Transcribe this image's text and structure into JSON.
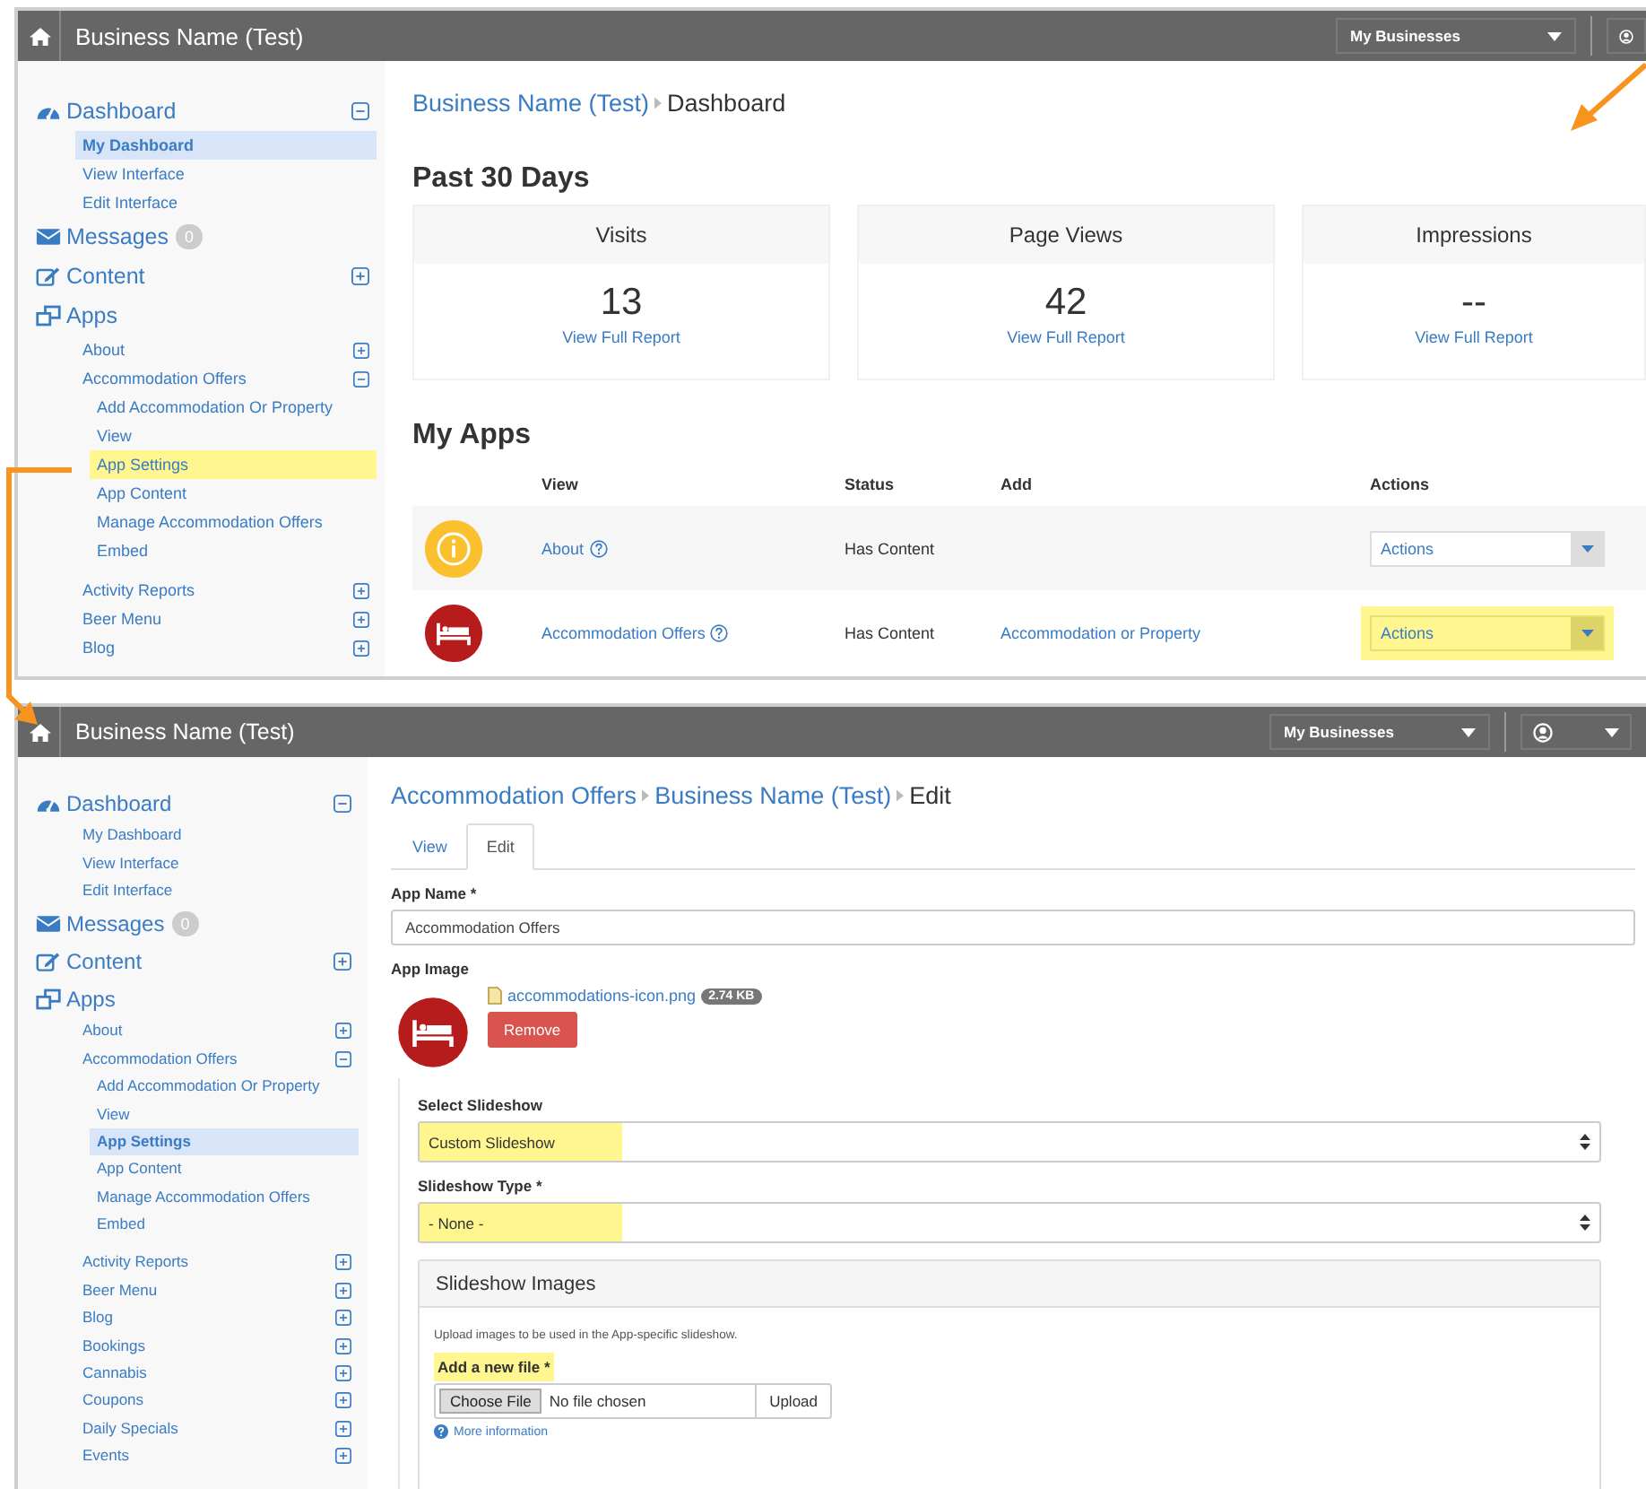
{
  "screens": [
    {
      "kind": "dashboard",
      "top_bar": {
        "title": "Business Name (Test)",
        "menu": "My Businesses",
        "user_caret": false
      },
      "sidebar": [
        {
          "label": "Dashboard",
          "expanded": true,
          "children": [
            {
              "label": "My Dashboard",
              "selected": true,
              "highlighted": false
            },
            {
              "label": "View Interface",
              "selected": false,
              "highlighted": false
            },
            {
              "label": "Edit Interface",
              "selected": false,
              "highlighted": false
            }
          ]
        },
        {
          "label": "Messages",
          "badge": "0"
        },
        {
          "label": "Content",
          "expanded": false
        },
        {
          "label": "Apps",
          "children": [
            {
              "label": "About",
              "expanded": false,
              "selected": false,
              "highlighted": false
            },
            {
              "label": "Accommodation Offers",
              "expanded": true,
              "selected": false,
              "highlighted": false,
              "children": [
                {
                  "label": "Add Accommodation Or Property",
                  "selected": false,
                  "highlighted": false
                },
                {
                  "label": "View",
                  "selected": false,
                  "highlighted": false
                },
                {
                  "label": "App Settings",
                  "selected": false,
                  "highlighted": true
                },
                {
                  "label": "App Content",
                  "selected": false,
                  "highlighted": false
                },
                {
                  "label": "Manage Accommodation Offers",
                  "selected": false,
                  "highlighted": false
                },
                {
                  "label": "Embed",
                  "selected": false,
                  "highlighted": false
                }
              ]
            },
            {
              "label": "Activity Reports",
              "expanded": false,
              "selected": false,
              "highlighted": false,
              "gap": true
            },
            {
              "label": "Beer Menu",
              "expanded": false,
              "selected": false,
              "highlighted": false
            },
            {
              "label": "Blog",
              "expanded": false,
              "selected": false,
              "highlighted": false
            }
          ]
        }
      ],
      "breadcrumb": [
        {
          "label": "Business Name (Test)",
          "link": true
        },
        {
          "label": "Dashboard",
          "link": false
        }
      ],
      "stats_title": "Past 30 Days",
      "stats": [
        {
          "label": "Visits",
          "value": "13",
          "link": "View Full Report"
        },
        {
          "label": "Page Views",
          "value": "42",
          "link": "View Full Report"
        },
        {
          "label": "Impressions",
          "value": "--",
          "link": "View Full Report"
        }
      ],
      "apps_title": "My Apps",
      "apps_table": {
        "columns": [
          "View",
          "Status",
          "Add",
          "Actions"
        ],
        "rows": [
          {
            "kind": "info",
            "color": "#fbc02d",
            "name": "About",
            "status": "Has Content",
            "action": "Actions",
            "highlighted": false
          },
          {
            "kind": "bed",
            "color": "#b71c1c",
            "name": "Accommodation Offers",
            "status": "Has Content",
            "add": "Accommodation or Property",
            "action": "Actions",
            "highlighted": true
          }
        ]
      }
    },
    {
      "kind": "edit",
      "top_bar": {
        "title": "Business Name (Test)",
        "menu": "My Businesses",
        "user_caret": true
      },
      "sidebar": [
        {
          "label": "Dashboard",
          "expanded": true,
          "children": [
            {
              "label": "My Dashboard",
              "selected": false,
              "highlighted": false
            },
            {
              "label": "View Interface",
              "selected": false,
              "highlighted": false
            },
            {
              "label": "Edit Interface",
              "selected": false,
              "highlighted": false
            }
          ]
        },
        {
          "label": "Messages",
          "badge": "0"
        },
        {
          "label": "Content",
          "expanded": false
        },
        {
          "label": "Apps",
          "children": [
            {
              "label": "About",
              "expanded": false,
              "selected": false,
              "highlighted": false
            },
            {
              "label": "Accommodation Offers",
              "expanded": true,
              "selected": false,
              "highlighted": false,
              "children": [
                {
                  "label": "Add Accommodation Or Property",
                  "selected": false,
                  "highlighted": false
                },
                {
                  "label": "View",
                  "selected": false,
                  "highlighted": false
                },
                {
                  "label": "App Settings",
                  "selected": true,
                  "highlighted": false
                },
                {
                  "label": "App Content",
                  "selected": false,
                  "highlighted": false
                },
                {
                  "label": "Manage Accommodation Offers",
                  "selected": false,
                  "highlighted": false
                },
                {
                  "label": "Embed",
                  "selected": false,
                  "highlighted": false
                }
              ]
            },
            {
              "label": "Activity Reports",
              "expanded": false,
              "selected": false,
              "highlighted": false,
              "gap": true
            },
            {
              "label": "Beer Menu",
              "expanded": false,
              "selected": false,
              "highlighted": false
            },
            {
              "label": "Blog",
              "expanded": false,
              "selected": false,
              "highlighted": false
            },
            {
              "label": "Bookings",
              "expanded": false,
              "selected": false,
              "highlighted": false
            },
            {
              "label": "Cannabis",
              "expanded": false,
              "selected": false,
              "highlighted": false
            },
            {
              "label": "Coupons",
              "expanded": false,
              "selected": false,
              "highlighted": false
            },
            {
              "label": "Daily Specials",
              "expanded": false,
              "selected": false,
              "highlighted": false
            },
            {
              "label": "Events",
              "expanded": false,
              "selected": false,
              "highlighted": false
            }
          ]
        }
      ],
      "breadcrumb": [
        {
          "label": "Accommodation Offers",
          "link": true
        },
        {
          "label": "Business Name (Test)",
          "link": true
        },
        {
          "label": "Edit",
          "link": false
        }
      ],
      "tabs": [
        {
          "label": "View",
          "selected": false
        },
        {
          "label": "Edit",
          "selected": true
        }
      ],
      "app_name": {
        "label": "App Name *",
        "value": "Accommodation Offers"
      },
      "app_image": {
        "label": "App Image",
        "color": "#b71c1c",
        "file": "accommodations-icon.png",
        "size": "2.74 KB",
        "remove": "Remove"
      },
      "slideshow_fields": [
        {
          "label": "Select Slideshow",
          "value": "Custom Slideshow",
          "highlighted": true
        },
        {
          "label": "Slideshow Type *",
          "value": "- None -",
          "highlighted": true
        }
      ],
      "slideshow_images": {
        "title": "Slideshow Images",
        "help": "Upload images to be used in the App-specific slideshow.",
        "file_label": "Add a new file *",
        "file_label_highlighted": true,
        "choose": "Choose File",
        "no_file": "No file chosen",
        "upload": "Upload",
        "more": "More information"
      }
    }
  ]
}
